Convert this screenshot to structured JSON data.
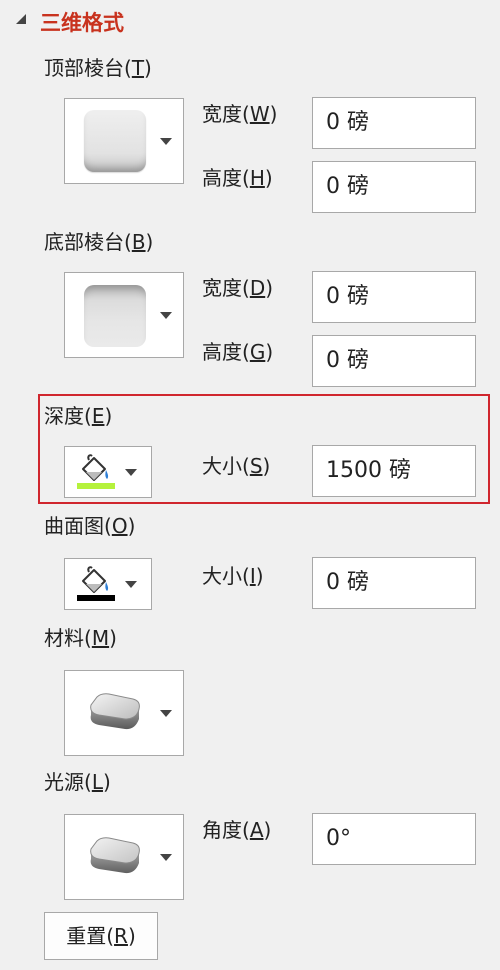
{
  "section": {
    "title": "三维格式"
  },
  "top_bevel": {
    "label": "顶部棱台",
    "key": "T",
    "width_label": "宽度",
    "width_key": "W",
    "width_value": "0 磅",
    "height_label": "高度",
    "height_key": "H",
    "height_value": "0 磅"
  },
  "bottom_bevel": {
    "label": "底部棱台",
    "key": "B",
    "width_label": "宽度",
    "width_key": "D",
    "width_value": "0 磅",
    "height_label": "高度",
    "height_key": "G",
    "height_value": "0 磅"
  },
  "depth": {
    "label": "深度",
    "key": "E",
    "size_label": "大小",
    "size_key": "S",
    "size_value": "1500 磅",
    "color": "#b5f23c"
  },
  "contour": {
    "label": "曲面图",
    "key": "O",
    "size_label": "大小",
    "size_key": "I",
    "size_value": "0 磅",
    "color": "#000000"
  },
  "material": {
    "label": "材料",
    "key": "M"
  },
  "lighting": {
    "label": "光源",
    "key": "L",
    "angle_label": "角度",
    "angle_key": "A",
    "angle_value": "0°"
  },
  "reset": {
    "label": "重置",
    "key": "R"
  },
  "colors": {
    "accent": "#c8321e",
    "highlight_border": "#d0262e"
  }
}
